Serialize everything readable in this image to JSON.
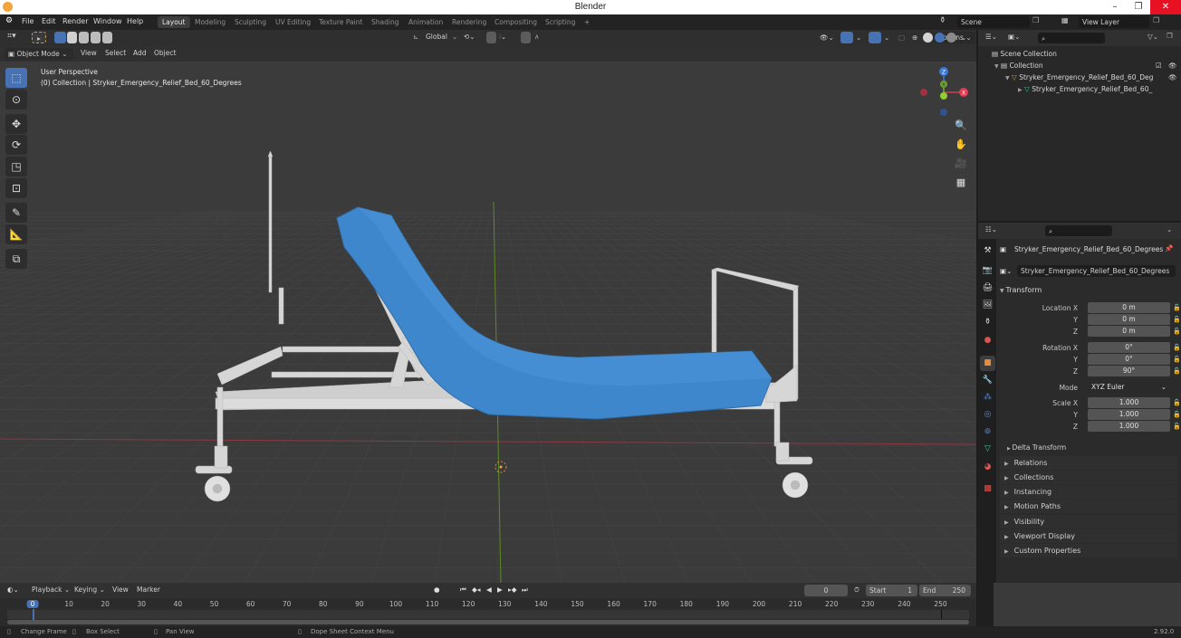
{
  "window": {
    "title": "Blender",
    "minimize": "–",
    "restore": "❐",
    "close": "✕"
  },
  "topbar": {
    "menus": [
      "File",
      "Edit",
      "Render",
      "Window",
      "Help"
    ],
    "workspaces": [
      "Layout",
      "Modeling",
      "Sculpting",
      "UV Editing",
      "Texture Paint",
      "Shading",
      "Animation",
      "Rendering",
      "Compositing",
      "Scripting"
    ],
    "active_workspace": "Layout",
    "add_workspace": "+",
    "scene": "Scene",
    "view_layer": "View Layer"
  },
  "viewport": {
    "header": {
      "transform_orientation": "Global",
      "options_label": "Options"
    },
    "header2": {
      "mode": "Object Mode",
      "menus": [
        "View",
        "Select",
        "Add",
        "Object"
      ]
    },
    "info_line1": "User Perspective",
    "info_line2": "(0) Collection | Stryker_Emergency_Relief_Bed_60_Degrees",
    "tools": [
      "select-box",
      "cursor",
      "move",
      "rotate",
      "scale",
      "transform",
      "annotate",
      "measure",
      "add-cube"
    ],
    "gizmo": {
      "x": "X",
      "y": "Y",
      "z": "Z"
    },
    "colors": {
      "mattress": "#3e85cb",
      "frame": "#d9d9d9",
      "grid": "#444444",
      "x_axis": "#a53a47",
      "y_axis": "#6b9a2a",
      "background": "#3b3b3b"
    }
  },
  "outliner": {
    "search_placeholder": "",
    "rows": [
      {
        "label": "Scene Collection",
        "icon": "scene-collection-icon"
      },
      {
        "label": "Collection",
        "icon": "collection-icon"
      },
      {
        "label": "Stryker_Emergency_Relief_Bed_60_Deg",
        "icon": "object-icon"
      },
      {
        "label": "Stryker_Emergency_Relief_Bed_60_",
        "icon": "mesh-icon"
      }
    ]
  },
  "properties": {
    "object_name": "Stryker_Emergency_Relief_Bed_60_Degrees",
    "object_field": "Stryker_Emergency_Relief_Bed_60_Degrees",
    "transform_label": "Transform",
    "location": {
      "label": "Location X",
      "x": "0 m",
      "y": "0 m",
      "z": "0 m"
    },
    "rotation": {
      "label": "Rotation X",
      "x": "0°",
      "y": "0°",
      "z": "90°"
    },
    "mode": {
      "label": "Mode",
      "value": "XYZ Euler"
    },
    "scale": {
      "label": "Scale X",
      "x": "1.000",
      "y": "1.000",
      "z": "1.000"
    },
    "axis_labels": {
      "y": "Y",
      "z": "Z"
    },
    "delta_transform": "Delta Transform",
    "sections": [
      "Relations",
      "Collections",
      "Instancing",
      "Motion Paths",
      "Visibility",
      "Viewport Display",
      "Custom Properties"
    ]
  },
  "timeline": {
    "menus": [
      "Playback",
      "Keying",
      "View",
      "Marker"
    ],
    "current_frame": "0",
    "start_label": "Start",
    "start": "1",
    "end_label": "End",
    "end": "250",
    "ticks": [
      "0",
      "10",
      "20",
      "30",
      "40",
      "50",
      "60",
      "70",
      "80",
      "90",
      "100",
      "110",
      "120",
      "130",
      "140",
      "150",
      "160",
      "170",
      "180",
      "190",
      "200",
      "210",
      "220",
      "230",
      "240",
      "250"
    ]
  },
  "statusbar": {
    "items": [
      "Change Frame",
      "Box Select",
      "Pan View",
      "Dope Sheet Context Menu"
    ],
    "version": "2.92.0"
  }
}
